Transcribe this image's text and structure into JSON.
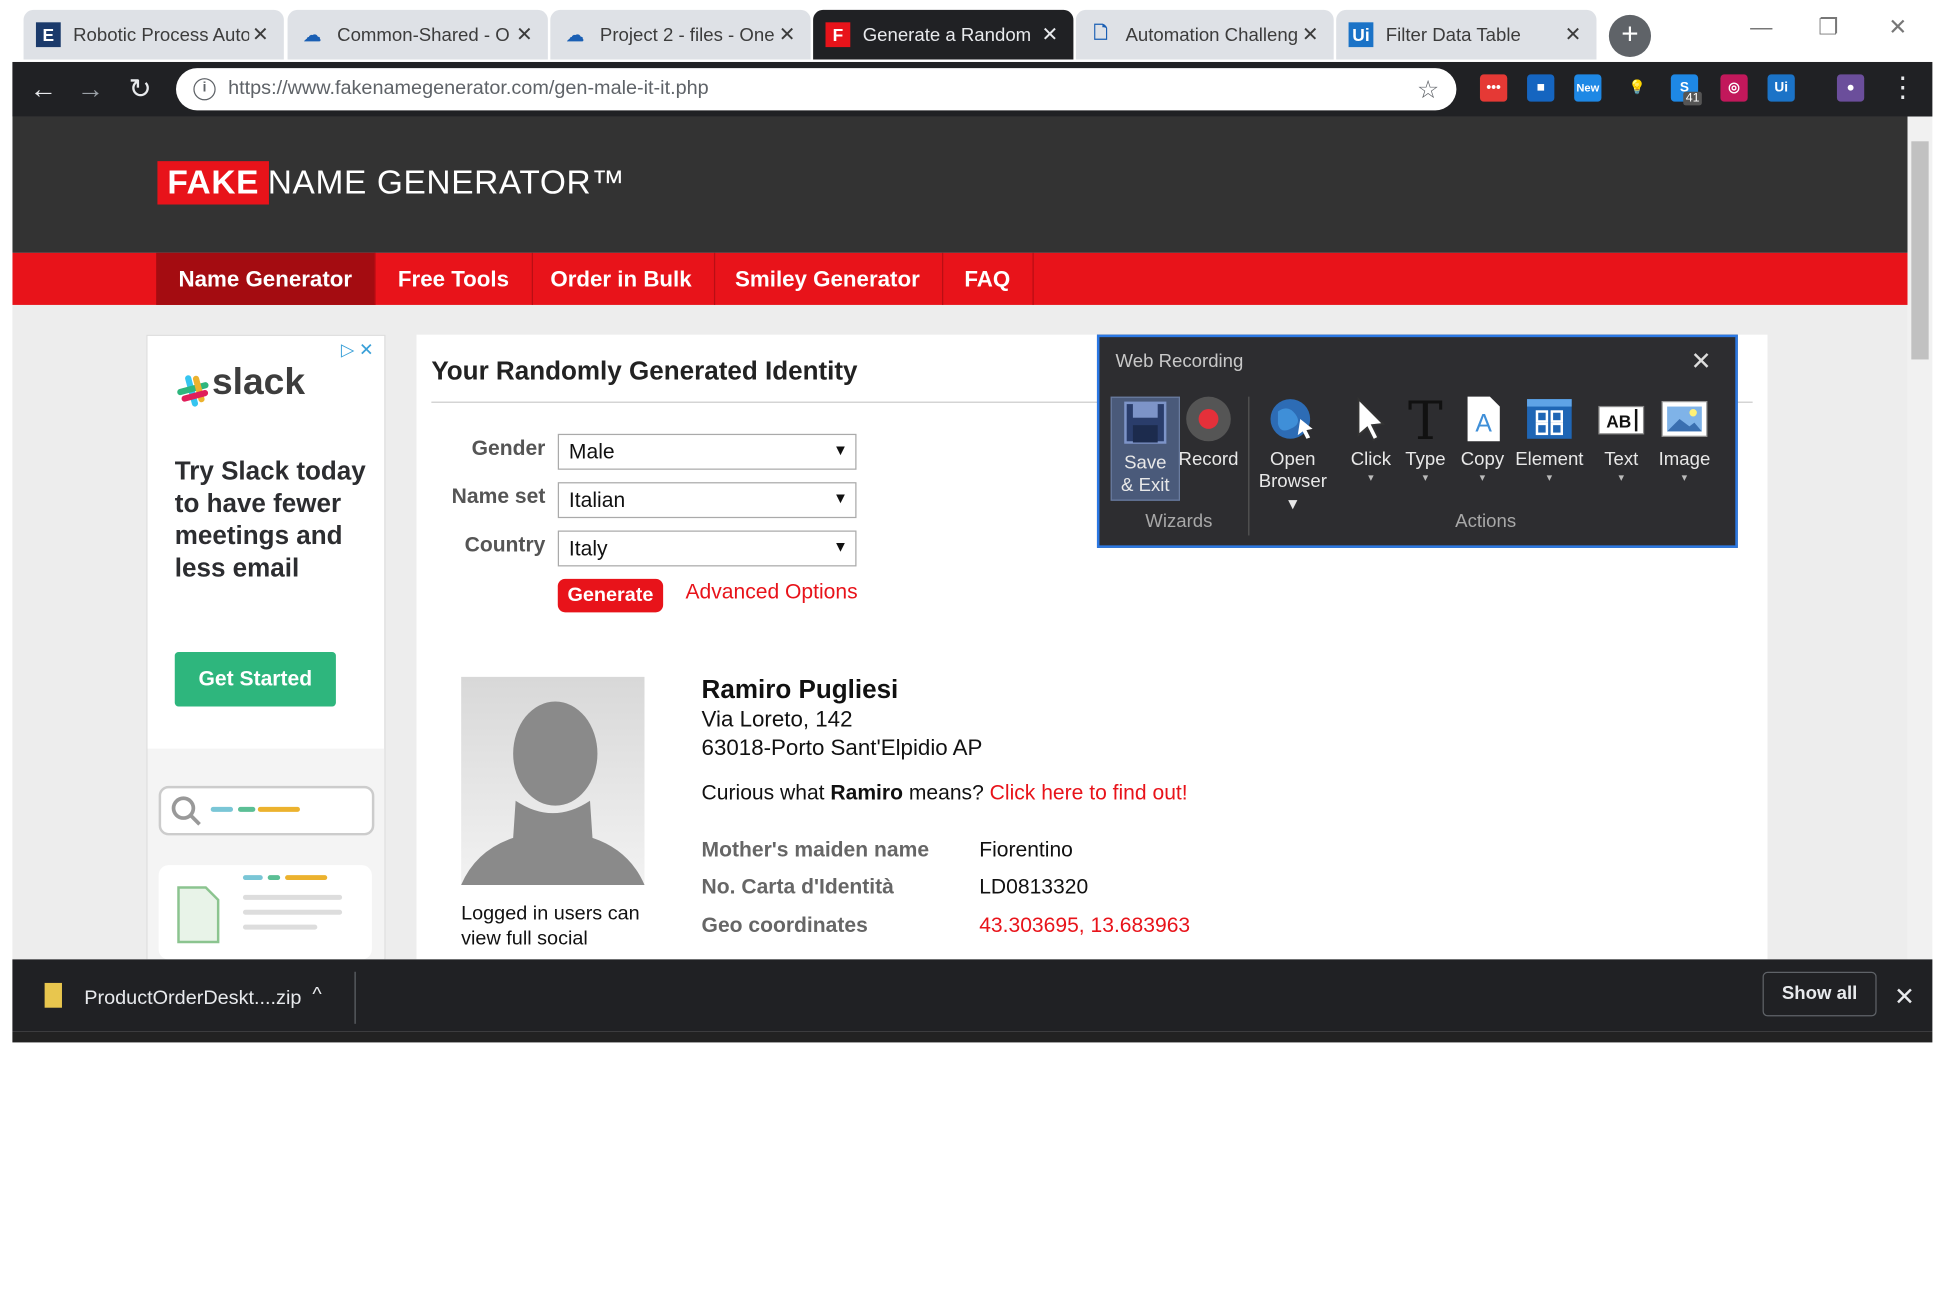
{
  "browser": {
    "tabs": [
      {
        "title": "Robotic Process Auto",
        "favicon": "E",
        "favicon_bg": "#1b3a6b",
        "close": "✕",
        "active": false
      },
      {
        "title": "Common-Shared - O",
        "favicon": "☁",
        "favicon_bg": "transparent",
        "close": "✕",
        "active": false
      },
      {
        "title": "Project 2 - files - One",
        "favicon": "☁",
        "favicon_bg": "transparent",
        "close": "✕",
        "active": false
      },
      {
        "title": "Generate a Random",
        "favicon": "F",
        "favicon_bg": "#e8131a",
        "close": "✕",
        "active": true
      },
      {
        "title": "Automation Challeng",
        "favicon": "🗋",
        "favicon_bg": "transparent",
        "close": "✕",
        "active": false
      },
      {
        "title": "Filter Data Table",
        "favicon": "Ui",
        "favicon_bg": "#1b73c7",
        "close": "✕",
        "active": false
      }
    ],
    "new_tab": "+",
    "window_controls": {
      "minimize": "—",
      "restore": "❐",
      "close": "✕"
    },
    "nav": {
      "back": "←",
      "forward": "→",
      "reload": "↻"
    },
    "url_scheme_host": "https://www.fakenamegenerator.com",
    "url_path": "/gen-male-it-it.php",
    "star": "☆",
    "extensions": [
      {
        "name": "ext-red",
        "glyph": "•••",
        "color": "#e53935"
      },
      {
        "name": "ext-blue-square",
        "glyph": "■",
        "color": "#1565c0"
      },
      {
        "name": "ext-new",
        "glyph": "New",
        "color": "#1e88e5"
      },
      {
        "name": "ext-bulb",
        "glyph": "💡",
        "color": "transparent"
      },
      {
        "name": "ext-skype",
        "glyph": "S",
        "color": "#1e88e5",
        "badge": "41"
      },
      {
        "name": "ext-instagram",
        "glyph": "◎",
        "color": "#c2185b"
      },
      {
        "name": "ext-uipath",
        "glyph": "Ui",
        "color": "#1b73c7"
      },
      {
        "name": "ext-avatar",
        "glyph": "●",
        "color": "#6b4e9b"
      }
    ],
    "menu": "⋮"
  },
  "site": {
    "logo_fake": "FAKE",
    "logo_name": "NAME GENERATOR™",
    "nav": [
      "Name Generator",
      "Free Tools",
      "Order in Bulk",
      "Smiley Generator",
      "FAQ"
    ],
    "active_nav": "Name Generator"
  },
  "ad": {
    "choices": "▷ ✕",
    "brand": "slack",
    "headline": "Try Slack today to have fewer meetings and less email",
    "cta": "Get Started"
  },
  "form": {
    "title": "Your Randomly Generated Identity",
    "gender_label": "Gender",
    "gender_value": "Male",
    "nameset_label": "Name set",
    "nameset_value": "Italian",
    "country_label": "Country",
    "country_value": "Italy",
    "generate": "Generate",
    "advanced": "Advanced Options",
    "select_arrow": "▼"
  },
  "identity": {
    "name": "Ramiro Pugliesi",
    "address_line1": "Via Loreto, 142",
    "address_line2": "63018-Porto Sant'Elpidio AP",
    "curious_prefix": "Curious what ",
    "curious_name": "Ramiro",
    "curious_mid": " means? ",
    "curious_link": "Click here to find out!",
    "photo_caption": "Logged in users can view full social",
    "details": [
      {
        "label": "Mother's maiden name",
        "value": "Fiorentino",
        "red": false
      },
      {
        "label": "No. Carta d'Identità",
        "value": "LD0813320",
        "red": false
      },
      {
        "label": "Geo coordinates",
        "value": "43.303695, 13.683963",
        "red": true
      }
    ]
  },
  "recorder": {
    "title": "Web Recording",
    "close": "✕",
    "tools": [
      {
        "id": "save",
        "label": "Save\n& Exit"
      },
      {
        "id": "record",
        "label": "Record"
      },
      {
        "id": "open",
        "label": "Open\nBrowser ▾"
      },
      {
        "id": "click",
        "label": "Click"
      },
      {
        "id": "type",
        "label": "Type"
      },
      {
        "id": "copy",
        "label": "Copy"
      },
      {
        "id": "element",
        "label": "Element"
      },
      {
        "id": "text",
        "label": "Text"
      },
      {
        "id": "image",
        "label": "Image"
      }
    ],
    "caret": "▾",
    "group_wizards": "Wizards",
    "group_actions": "Actions"
  },
  "download": {
    "filename": "ProductOrderDeskt....zip",
    "caret": "^",
    "show_all": "Show all",
    "close": "✕"
  },
  "colors": {
    "brand_red": "#e8131a",
    "header_dark": "#333333",
    "chrome_dark": "#202124",
    "recorder_border": "#2b78e4"
  }
}
